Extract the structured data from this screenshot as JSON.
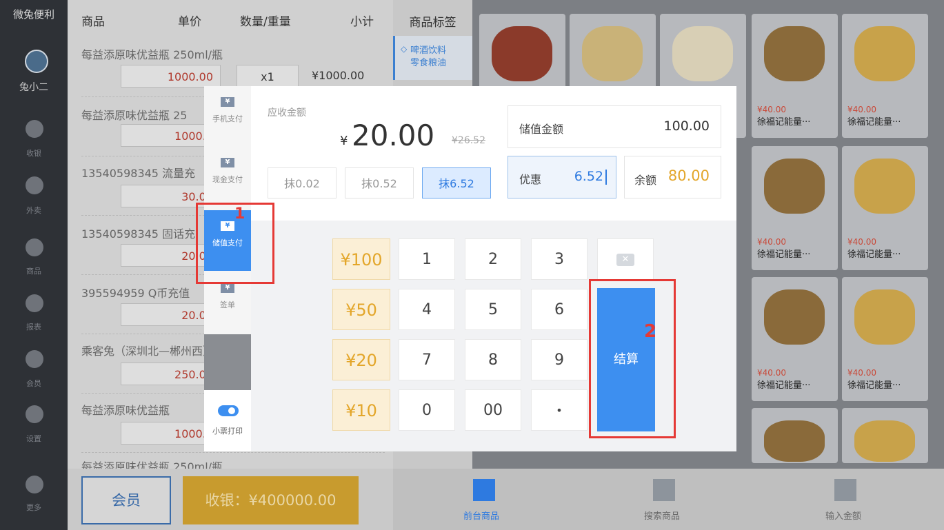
{
  "sidebar": {
    "app_name": "微兔便利",
    "user_name": "兔小二",
    "items": [
      {
        "label": "收银"
      },
      {
        "label": "外卖"
      },
      {
        "label": "商品"
      },
      {
        "label": "报表"
      },
      {
        "label": "会员"
      },
      {
        "label": "设置"
      },
      {
        "label": "更多"
      }
    ]
  },
  "order": {
    "headers": {
      "product": "商品",
      "unit_price": "单价",
      "qty": "数量/重量",
      "subtotal": "小计"
    },
    "rows": [
      {
        "name": "每益添原味优益瓶  250ml/瓶",
        "price": "1000.00",
        "qty": "x1",
        "subtotal": "¥1000.00"
      },
      {
        "name": "每益添原味优益瓶  25",
        "price": "1000.0"
      },
      {
        "name": "13540598345  流量充",
        "price": "30.00"
      },
      {
        "name": "13540598345  固话充",
        "price": "20.00"
      },
      {
        "name": "395594959  Q币充值",
        "price": "20.00"
      },
      {
        "name": "乘客兔（深圳北—郴州西）  二",
        "price": "250.00"
      },
      {
        "name": "每益添原味优益瓶",
        "price": "1000.0"
      },
      {
        "name": "每益添原味优益瓶  250ml/瓶"
      }
    ],
    "member_button": "会员",
    "checkout_button": "收银：¥400000.00"
  },
  "tags": {
    "title": "商品标签",
    "active_line1": "啤酒饮料",
    "active_line2": "零食粮油"
  },
  "products": [
    {
      "price": "¥40.00",
      "name": "徐福记能量···"
    },
    {
      "price": "¥40.00",
      "name": "徐福记能量···"
    },
    {
      "price": "¥40.00",
      "name": "徐福记能量···"
    },
    {
      "price": "¥40.00",
      "name": "徐福记能量···"
    },
    {
      "price": "¥40.00",
      "name": "徐福记能量···"
    },
    {
      "price": "¥40.00",
      "name": "徐福记能量···"
    }
  ],
  "bottom_nav": {
    "front_goods": "前台商品",
    "search_goods": "搜索商品",
    "input_amount": "输入金额",
    "active_color": "#2e7ae0"
  },
  "payment": {
    "tabs": [
      {
        "label": "手机支付"
      },
      {
        "label": "现金支付"
      },
      {
        "label": "储值支付"
      },
      {
        "label": "签单"
      }
    ],
    "tab_icon": "¥",
    "print_label": "小票打印",
    "print_enabled": true,
    "due_label": "应收金额",
    "due_currency": "¥",
    "due_amount": "20.00",
    "original_amount": "¥26.52",
    "wipe_options": [
      "抹0.02",
      "抹0.52",
      "抹6.52"
    ],
    "stored_value_label": "储值金额",
    "stored_value": "100.00",
    "discount_label": "优惠",
    "discount_value": "6.52",
    "balance_label": "余额",
    "balance_value": "80.00",
    "quick_amounts": [
      "¥100",
      "¥50",
      "¥20",
      "¥10"
    ],
    "keys": [
      "1",
      "2",
      "3",
      "4",
      "5",
      "6",
      "7",
      "8",
      "9",
      "0",
      "00",
      "•"
    ],
    "settle_button": "结算",
    "accent_color": "#3d8ff0"
  },
  "annotations": {
    "mark1": "1",
    "mark2": "2"
  }
}
